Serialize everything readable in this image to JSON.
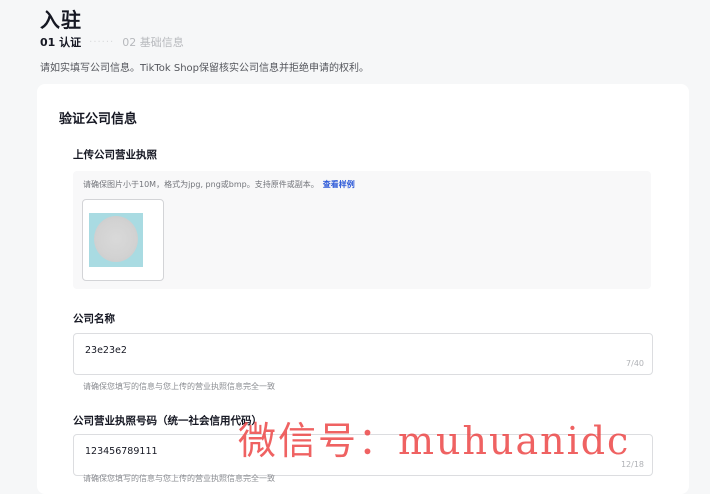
{
  "header": {
    "title": "入驻",
    "steps": [
      {
        "label": "01 认证"
      },
      {
        "label": "02 基础信息"
      }
    ],
    "step_dots": "······",
    "intro": "请如实填写公司信息。TikTok Shop保留核实公司信息并拒绝申请的权利。"
  },
  "card": {
    "title": "验证公司信息",
    "license_upload": {
      "label": "上传公司营业执照",
      "hint": "请确保图片小于10M，格式为jpg, png或bmp。支持原件或副本。",
      "sample_link": "查看样例"
    },
    "company_name": {
      "label": "公司名称",
      "value": "23e23e2",
      "count": "7/40",
      "help": "请确保您填写的信息与您上传的营业执照信息完全一致"
    },
    "license_number": {
      "label": "公司营业执照号码（统一社会信用代码）",
      "value": "123456789111",
      "count": "12/18",
      "help": "请确保您填写的信息与您上传的营业执照信息完全一致"
    }
  },
  "watermark": "微信号：muhuanidc"
}
